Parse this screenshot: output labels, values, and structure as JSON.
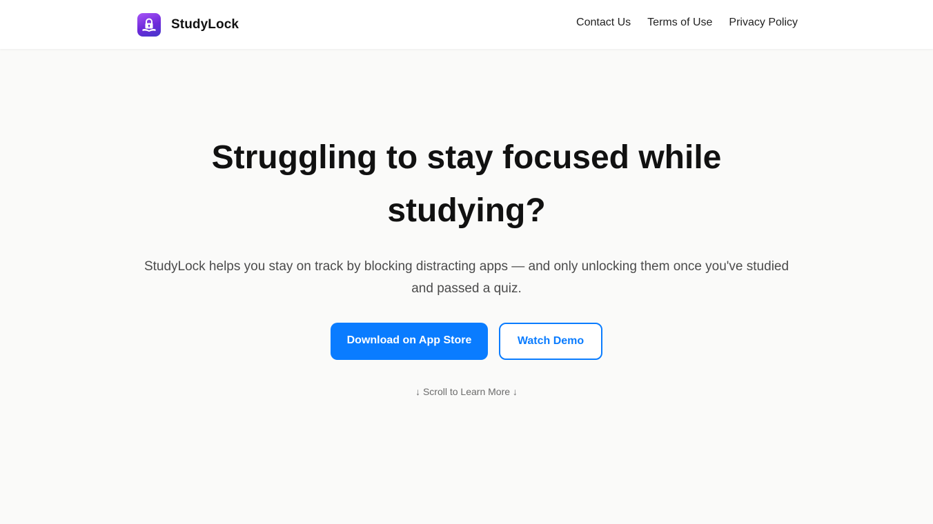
{
  "header": {
    "brand_name": "StudyLock",
    "logo_icon": "lock-book-icon",
    "nav": [
      "Contact Us",
      "Terms of Use",
      "Privacy Policy"
    ]
  },
  "hero": {
    "headline": "Struggling to stay focused while studying?",
    "subtitle": "StudyLock helps you stay on track by blocking distracting apps — and only unlocking them once you've studied and passed a quiz.",
    "primary_button": "Download on App Store",
    "secondary_button": "Watch Demo",
    "scroll_hint": "↓ Scroll to Learn More ↓"
  },
  "colors": {
    "accent": "#0a7cff",
    "logo_gradient_start": "#a855f7",
    "logo_gradient_end": "#4338ca",
    "background": "#fafaf9"
  }
}
